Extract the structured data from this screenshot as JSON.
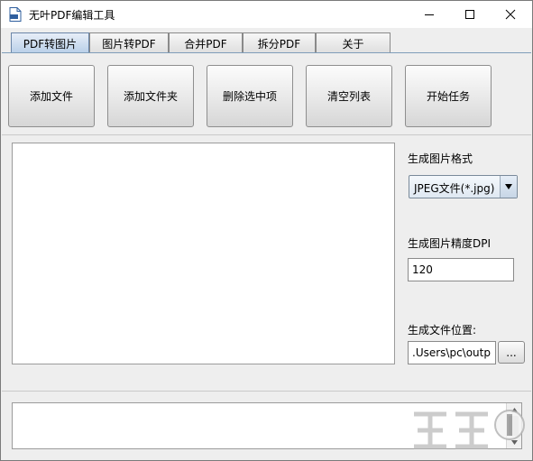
{
  "window": {
    "title": "无叶PDF编辑工具",
    "controls": {
      "minimize": "─",
      "maximize": "☐",
      "close": "✕"
    }
  },
  "tabs": [
    {
      "label": "PDF转图片",
      "active": true
    },
    {
      "label": "图片转PDF",
      "active": false
    },
    {
      "label": "合并PDF",
      "active": false
    },
    {
      "label": "拆分PDF",
      "active": false
    },
    {
      "label": "关于",
      "active": false
    }
  ],
  "toolbar": {
    "add_file": "添加文件",
    "add_folder": "添加文件夹",
    "delete_selected": "删除选中项",
    "clear_list": "清空列表",
    "start_task": "开始任务"
  },
  "options": {
    "format_label": "生成图片格式",
    "format_value": "JPEG文件(*.jpg)",
    "dpi_label": "生成图片精度DPI",
    "dpi_value": "120",
    "location_label": "生成文件位置:",
    "location_value": ".Users\\pc\\output",
    "browse_label": "..."
  },
  "icons": {
    "app": "pdf-file-icon",
    "dropdown": "triangle-down-icon",
    "scroll_up": "triangle-up-icon",
    "scroll_down": "triangle-down-icon"
  },
  "colors": {
    "active_tab": "#b8cfe8",
    "tab_underline": "#7f9db9",
    "window_bg": "#eeeeee"
  }
}
